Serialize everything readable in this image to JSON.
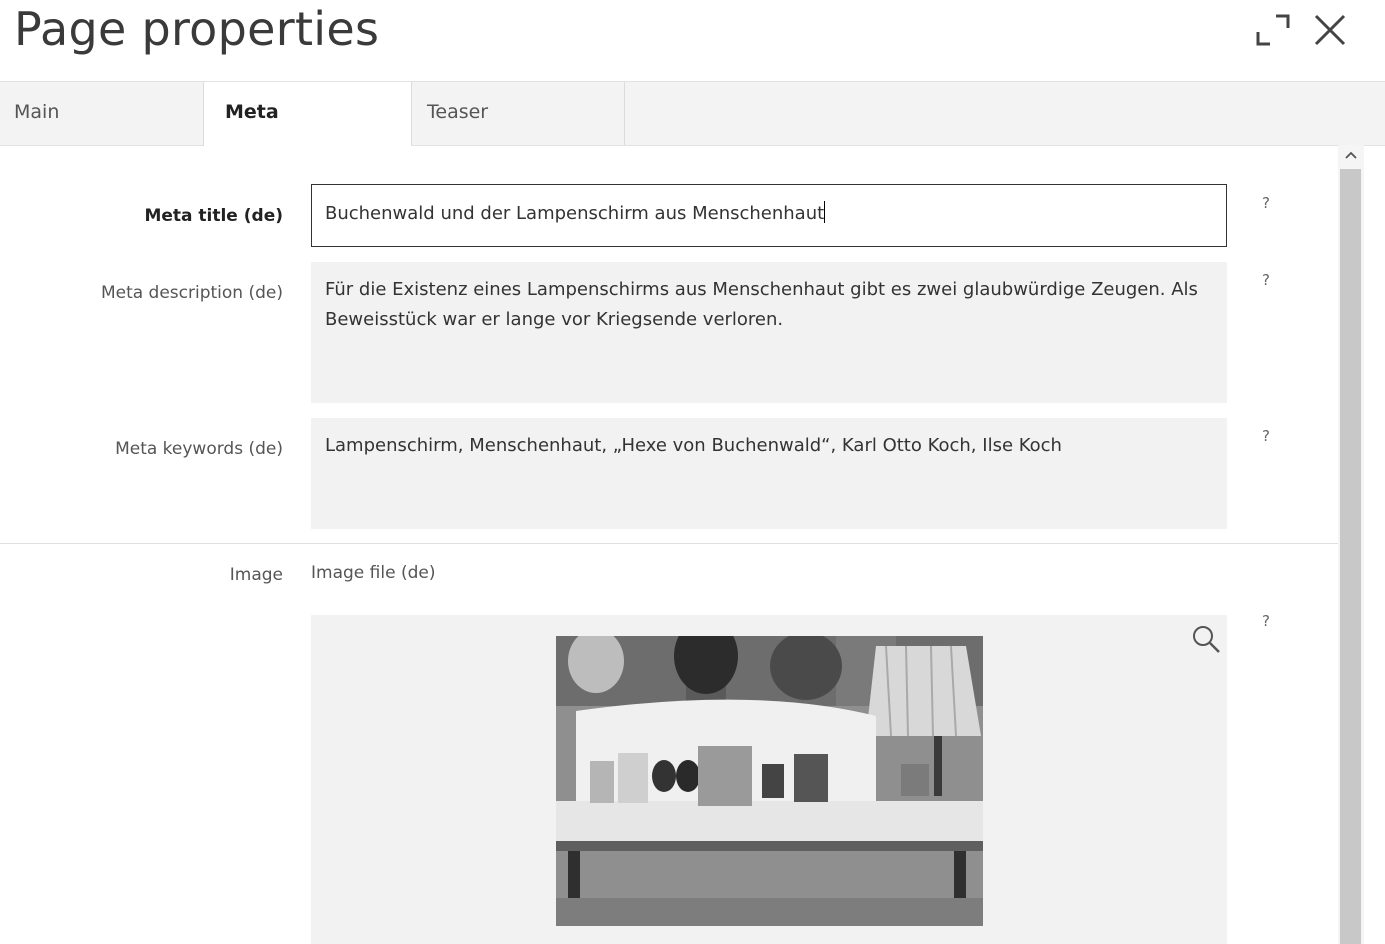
{
  "window": {
    "title": "Page properties",
    "maximize_icon": "maximize-icon",
    "close_icon": "close-icon"
  },
  "tabs": [
    {
      "label": "Main",
      "active": false
    },
    {
      "label": "Meta",
      "active": true
    },
    {
      "label": "Teaser",
      "active": false
    }
  ],
  "fields": {
    "meta_title": {
      "label": "Meta title (de)",
      "value": "Buchenwald und der Lampenschirm aus Menschenhaut",
      "help": "?"
    },
    "meta_description": {
      "label": "Meta description (de)",
      "value": "Für die Existenz eines Lampenschirms aus Menschenhaut gibt es zwei glaubwürdige Zeugen. Als Beweisstück war er lange vor Kriegsende verloren.",
      "help": "?"
    },
    "meta_keywords": {
      "label": "Meta keywords (de)",
      "value": "Lampenschirm, Menschenhaut, „Hexe von Buchenwald“, Karl Otto Koch, Ilse Koch",
      "help": "?"
    },
    "image": {
      "label": "Image",
      "sub_label": "Image file (de)",
      "help": "?",
      "zoom_icon": "zoom-icon"
    }
  },
  "scrollbar": {
    "up_icon": "chevron-up-icon"
  },
  "colors": {
    "field_bg": "#f2f2f2",
    "tab_bg": "#f3f3f3",
    "focus_border": "#333333"
  }
}
